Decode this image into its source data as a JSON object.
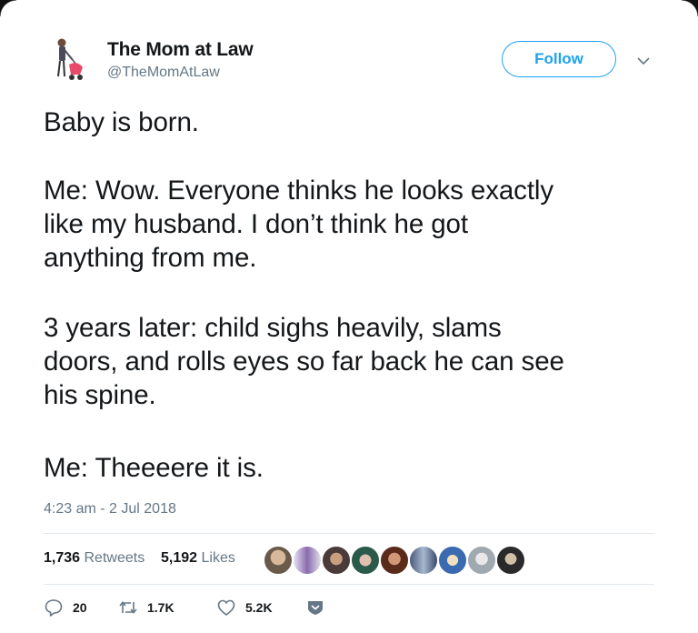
{
  "author": {
    "name": "The Mom at Law",
    "handle": "@TheMomAtLaw"
  },
  "follow_button": {
    "label": "Follow"
  },
  "tweet": {
    "paragraphs": [
      [
        "Baby is born."
      ],
      [
        "Me: Wow. Everyone thinks he looks exactly",
        "like my husband. I don’t think he got",
        "anything from me."
      ],
      [
        "3 years later: child sighs heavily, slams",
        "doors, and rolls eyes so far back he can see",
        "his spine."
      ],
      [
        "Me: Theeeere it is."
      ]
    ],
    "timestamp": "4:23 am - 2 Jul 2018"
  },
  "stats": {
    "retweets_count": "1,736",
    "retweets_label": "Retweets",
    "likes_count": "5,192",
    "likes_label": "Likes"
  },
  "actions": {
    "reply_count": "20",
    "retweet_count": "1.7K",
    "like_count": "5.2K"
  },
  "icons": {
    "follow_menu": "chevron-down-icon",
    "reply": "reply-icon",
    "retweet": "retweet-icon",
    "like": "heart-icon",
    "direct_message": "direct-message-icon"
  },
  "colors": {
    "accent": "#1da1f2",
    "text": "#14171a",
    "secondary": "#657786",
    "divider": "#e1e8ed"
  }
}
